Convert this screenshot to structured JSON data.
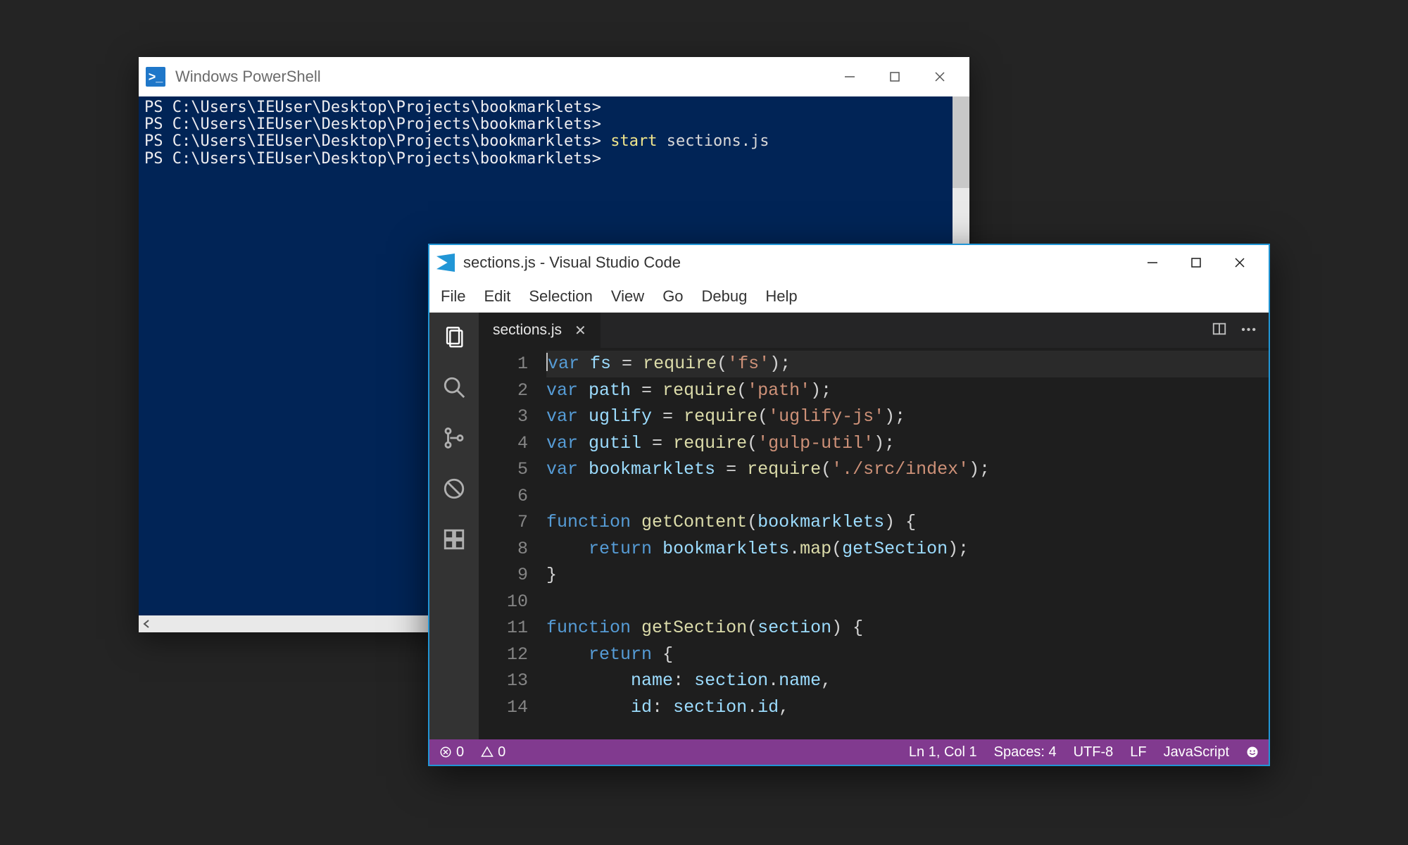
{
  "powershell": {
    "title": "Windows PowerShell",
    "prompt": "PS C:\\Users\\IEUser\\Desktop\\Projects\\bookmarklets>",
    "lines": [
      {
        "cmd": "",
        "arg": ""
      },
      {
        "cmd": "",
        "arg": ""
      },
      {
        "cmd": "start",
        "arg": "sections.js"
      },
      {
        "cmd": "",
        "arg": ""
      }
    ]
  },
  "vscode": {
    "title": "sections.js - Visual Studio Code",
    "menu": [
      "File",
      "Edit",
      "Selection",
      "View",
      "Go",
      "Debug",
      "Help"
    ],
    "tab": {
      "name": "sections.js"
    },
    "code": [
      [
        {
          "t": "var ",
          "c": "kw"
        },
        {
          "t": "fs",
          "c": "id"
        },
        {
          "t": " = ",
          "c": "pn"
        },
        {
          "t": "require",
          "c": "fn-name"
        },
        {
          "t": "(",
          "c": "pn"
        },
        {
          "t": "'fs'",
          "c": "str"
        },
        {
          "t": ");",
          "c": "pn"
        }
      ],
      [
        {
          "t": "var ",
          "c": "kw"
        },
        {
          "t": "path",
          "c": "id"
        },
        {
          "t": " = ",
          "c": "pn"
        },
        {
          "t": "require",
          "c": "fn-name"
        },
        {
          "t": "(",
          "c": "pn"
        },
        {
          "t": "'path'",
          "c": "str"
        },
        {
          "t": ");",
          "c": "pn"
        }
      ],
      [
        {
          "t": "var ",
          "c": "kw"
        },
        {
          "t": "uglify",
          "c": "id"
        },
        {
          "t": " = ",
          "c": "pn"
        },
        {
          "t": "require",
          "c": "fn-name"
        },
        {
          "t": "(",
          "c": "pn"
        },
        {
          "t": "'uglify-js'",
          "c": "str"
        },
        {
          "t": ");",
          "c": "pn"
        }
      ],
      [
        {
          "t": "var ",
          "c": "kw"
        },
        {
          "t": "gutil",
          "c": "id"
        },
        {
          "t": " = ",
          "c": "pn"
        },
        {
          "t": "require",
          "c": "fn-name"
        },
        {
          "t": "(",
          "c": "pn"
        },
        {
          "t": "'gulp-util'",
          "c": "str"
        },
        {
          "t": ");",
          "c": "pn"
        }
      ],
      [
        {
          "t": "var ",
          "c": "kw"
        },
        {
          "t": "bookmarklets",
          "c": "id"
        },
        {
          "t": " = ",
          "c": "pn"
        },
        {
          "t": "require",
          "c": "fn-name"
        },
        {
          "t": "(",
          "c": "pn"
        },
        {
          "t": "'./src/index'",
          "c": "str"
        },
        {
          "t": ");",
          "c": "pn"
        }
      ],
      [],
      [
        {
          "t": "function ",
          "c": "kw"
        },
        {
          "t": "getContent",
          "c": "fn-name"
        },
        {
          "t": "(",
          "c": "pn"
        },
        {
          "t": "bookmarklets",
          "c": "id"
        },
        {
          "t": ") {",
          "c": "pn"
        }
      ],
      [
        {
          "t": "    ",
          "c": "pn"
        },
        {
          "t": "return ",
          "c": "kw"
        },
        {
          "t": "bookmarklets",
          "c": "id"
        },
        {
          "t": ".",
          "c": "pn"
        },
        {
          "t": "map",
          "c": "fn-name"
        },
        {
          "t": "(",
          "c": "pn"
        },
        {
          "t": "getSection",
          "c": "id"
        },
        {
          "t": ");",
          "c": "pn"
        }
      ],
      [
        {
          "t": "}",
          "c": "pn"
        }
      ],
      [],
      [
        {
          "t": "function ",
          "c": "kw"
        },
        {
          "t": "getSection",
          "c": "fn-name"
        },
        {
          "t": "(",
          "c": "pn"
        },
        {
          "t": "section",
          "c": "id"
        },
        {
          "t": ") {",
          "c": "pn"
        }
      ],
      [
        {
          "t": "    ",
          "c": "pn"
        },
        {
          "t": "return ",
          "c": "kw"
        },
        {
          "t": "{",
          "c": "pn"
        }
      ],
      [
        {
          "t": "        ",
          "c": "pn"
        },
        {
          "t": "name",
          "c": "id"
        },
        {
          "t": ": ",
          "c": "pn"
        },
        {
          "t": "section",
          "c": "id"
        },
        {
          "t": ".",
          "c": "pn"
        },
        {
          "t": "name",
          "c": "id"
        },
        {
          "t": ",",
          "c": "pn"
        }
      ],
      [
        {
          "t": "        ",
          "c": "pn"
        },
        {
          "t": "id",
          "c": "id"
        },
        {
          "t": ": ",
          "c": "pn"
        },
        {
          "t": "section",
          "c": "id"
        },
        {
          "t": ".",
          "c": "pn"
        },
        {
          "t": "id",
          "c": "id"
        },
        {
          "t": ",",
          "c": "pn"
        }
      ]
    ],
    "status": {
      "errors": "0",
      "warnings": "0",
      "position": "Ln 1, Col 1",
      "spaces": "Spaces: 4",
      "encoding": "UTF-8",
      "eol": "LF",
      "language": "JavaScript"
    }
  }
}
